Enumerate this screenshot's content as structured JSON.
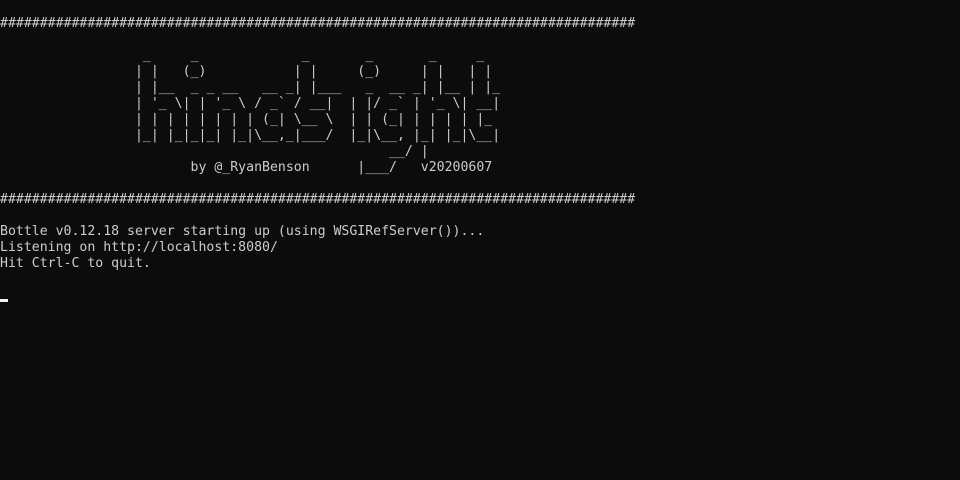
{
  "terminal": {
    "colors": {
      "background": "#0c0c0c",
      "text": "#cccccc",
      "cursor": "#f2f2f2"
    },
    "lines": [
      "################################################################################",
      "",
      "                  _     _             _       _       _     _",
      "                 | |   (_)           | |     (_)     | |   | |",
      "                 | |__  _ _ __   __ _| |___   _  __ _| |__ | |_",
      "                 | '_ \\| | '_ \\ / _` / __|  | |/ _` | '_ \\| __|",
      "                 | | | | | | | | (_| \\__ \\  | | (_| | | | | |_",
      "                 |_| |_|_|_| |_|\\__,_|___/  |_|\\__, |_| |_|\\__|",
      "                                                 __/ |",
      "                        by @_RyanBenson      |___/   v20200607",
      "",
      "################################################################################",
      "",
      "Bottle v0.12.18 server starting up (using WSGIRefServer())...",
      "Listening on http://localhost:8080/",
      "Hit Ctrl-C to quit.",
      ""
    ]
  }
}
